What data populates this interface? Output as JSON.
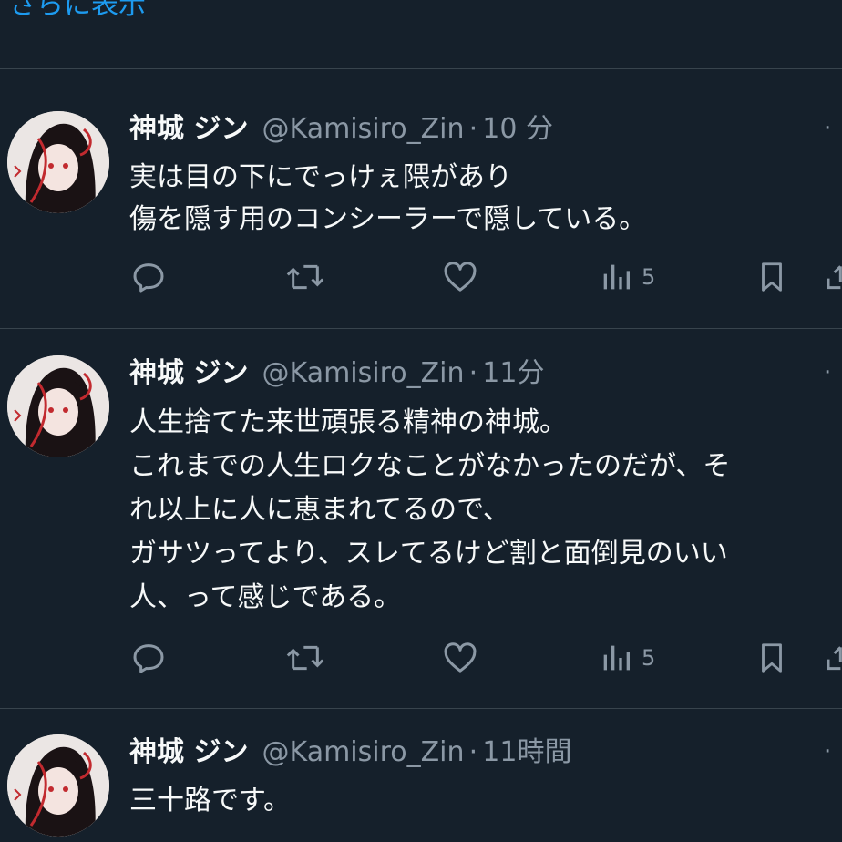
{
  "show_more_label": "さらに表示",
  "tweets": [
    {
      "display_name": "神城 ジン",
      "handle": "@Kamisiro_Zin",
      "time": "10 分",
      "lines": [
        "実は目の下にでっけぇ隈があり",
        "傷を隠す用のコンシーラーで隠している。"
      ],
      "views": "5"
    },
    {
      "display_name": "神城 ジン",
      "handle": "@Kamisiro_Zin",
      "time": "11分",
      "lines": [
        "人生捨てた来世頑張る精神の神城。",
        "これまでの人生ロクなことがなかったのだが、そ",
        "れ以上に人に恵まれてるので、",
        "ガサツってより、スレてるけど割と面倒見のいい",
        "人、って感じである。"
      ],
      "views": "5"
    },
    {
      "display_name": "神城 ジン",
      "handle": "@Kamisiro_Zin",
      "time": "11時間",
      "lines": [
        "三十路です。"
      ],
      "views": ""
    }
  ],
  "icons": {
    "reply": "reply-icon",
    "retweet": "retweet-icon",
    "like": "heart-icon",
    "views": "views-icon",
    "bookmark": "bookmark-icon",
    "share": "share-icon",
    "more": "more-icon"
  },
  "colors": {
    "background": "#15202b",
    "accent": "#1d9bf0",
    "secondary_text": "#8b98a5",
    "divider": "#38444d"
  }
}
